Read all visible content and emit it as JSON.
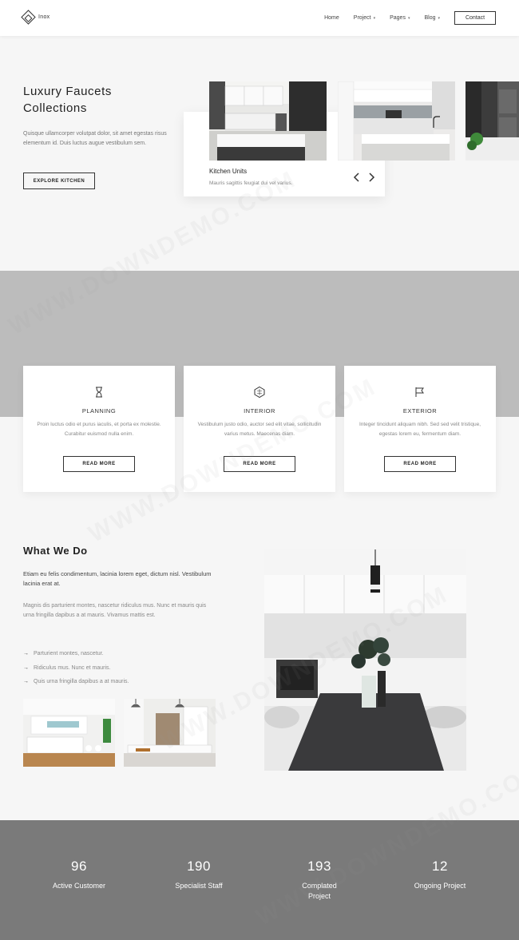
{
  "header": {
    "logo": "Inox",
    "nav": [
      {
        "label": "Home",
        "caret": false
      },
      {
        "label": "Project",
        "caret": true
      },
      {
        "label": "Pages",
        "caret": true
      },
      {
        "label": "Blog",
        "caret": true
      }
    ],
    "contact_label": "Contact"
  },
  "hero": {
    "title_line1": "Luxury Faucets",
    "title_line2": "Collections",
    "text": "Quisque ullamcorper volutpat dolor, sit amet egestas risus elementum id. Duis luctus augue vestibulum sem.",
    "button": "EXPLORE KITCHEN",
    "card_title": "Kitchen Units",
    "card_text": "Mauris sagittis feugiat dui vel varius.",
    "prev_icon": "chevron-left-icon",
    "next_icon": "chevron-right-icon"
  },
  "services": [
    {
      "icon": "hourglass-icon",
      "title": "PLANNING",
      "text": "Proin luctus odio et purus iaculis, et porta ex molestie. Curabitur euismod nulla enim.",
      "button": "READ MORE"
    },
    {
      "icon": "hexagon-icon",
      "title": "INTERIOR",
      "text": "Vestibulum justo odio, auctor sed elit vitae, sollicitudin varius metus. Maecenas diam.",
      "button": "READ MORE"
    },
    {
      "icon": "flag-icon",
      "title": "EXTERIOR",
      "text": "Integer tincidunt aliquam nibh. Sed sed velit tristique, egestas lorem eu, fermentum diam.",
      "button": "READ MORE"
    }
  ],
  "what_we_do": {
    "title": "What We Do",
    "lead": "Etiam eu felis condimentum, lacinia lorem eget, dictum nisl. Vestibulum lacinia erat at.",
    "body": "Magnis dis parturient montes, nascetur ridiculus mus. Nunc et mauris quis urna fringilla dapibus a at mauris. Vivamus mattis est.",
    "list": [
      "Parturient montes, nascetur.",
      "Ridiculus mus. Nunc et mauris.",
      "Quis urna fringilla dapibus a at mauris."
    ]
  },
  "stats": [
    {
      "value": "96",
      "label": "Active Customer"
    },
    {
      "value": "190",
      "label": "Specialist Staff"
    },
    {
      "value": "193",
      "label": "Complated Project"
    },
    {
      "value": "12",
      "label": "Ongoing Project"
    }
  ],
  "watermark": "WWW.DOWNDEMO.COM",
  "colors": {
    "band_gray": "#bcbcbc",
    "stats_gray": "#7a7a7a",
    "page_bg": "#f6f6f6"
  }
}
